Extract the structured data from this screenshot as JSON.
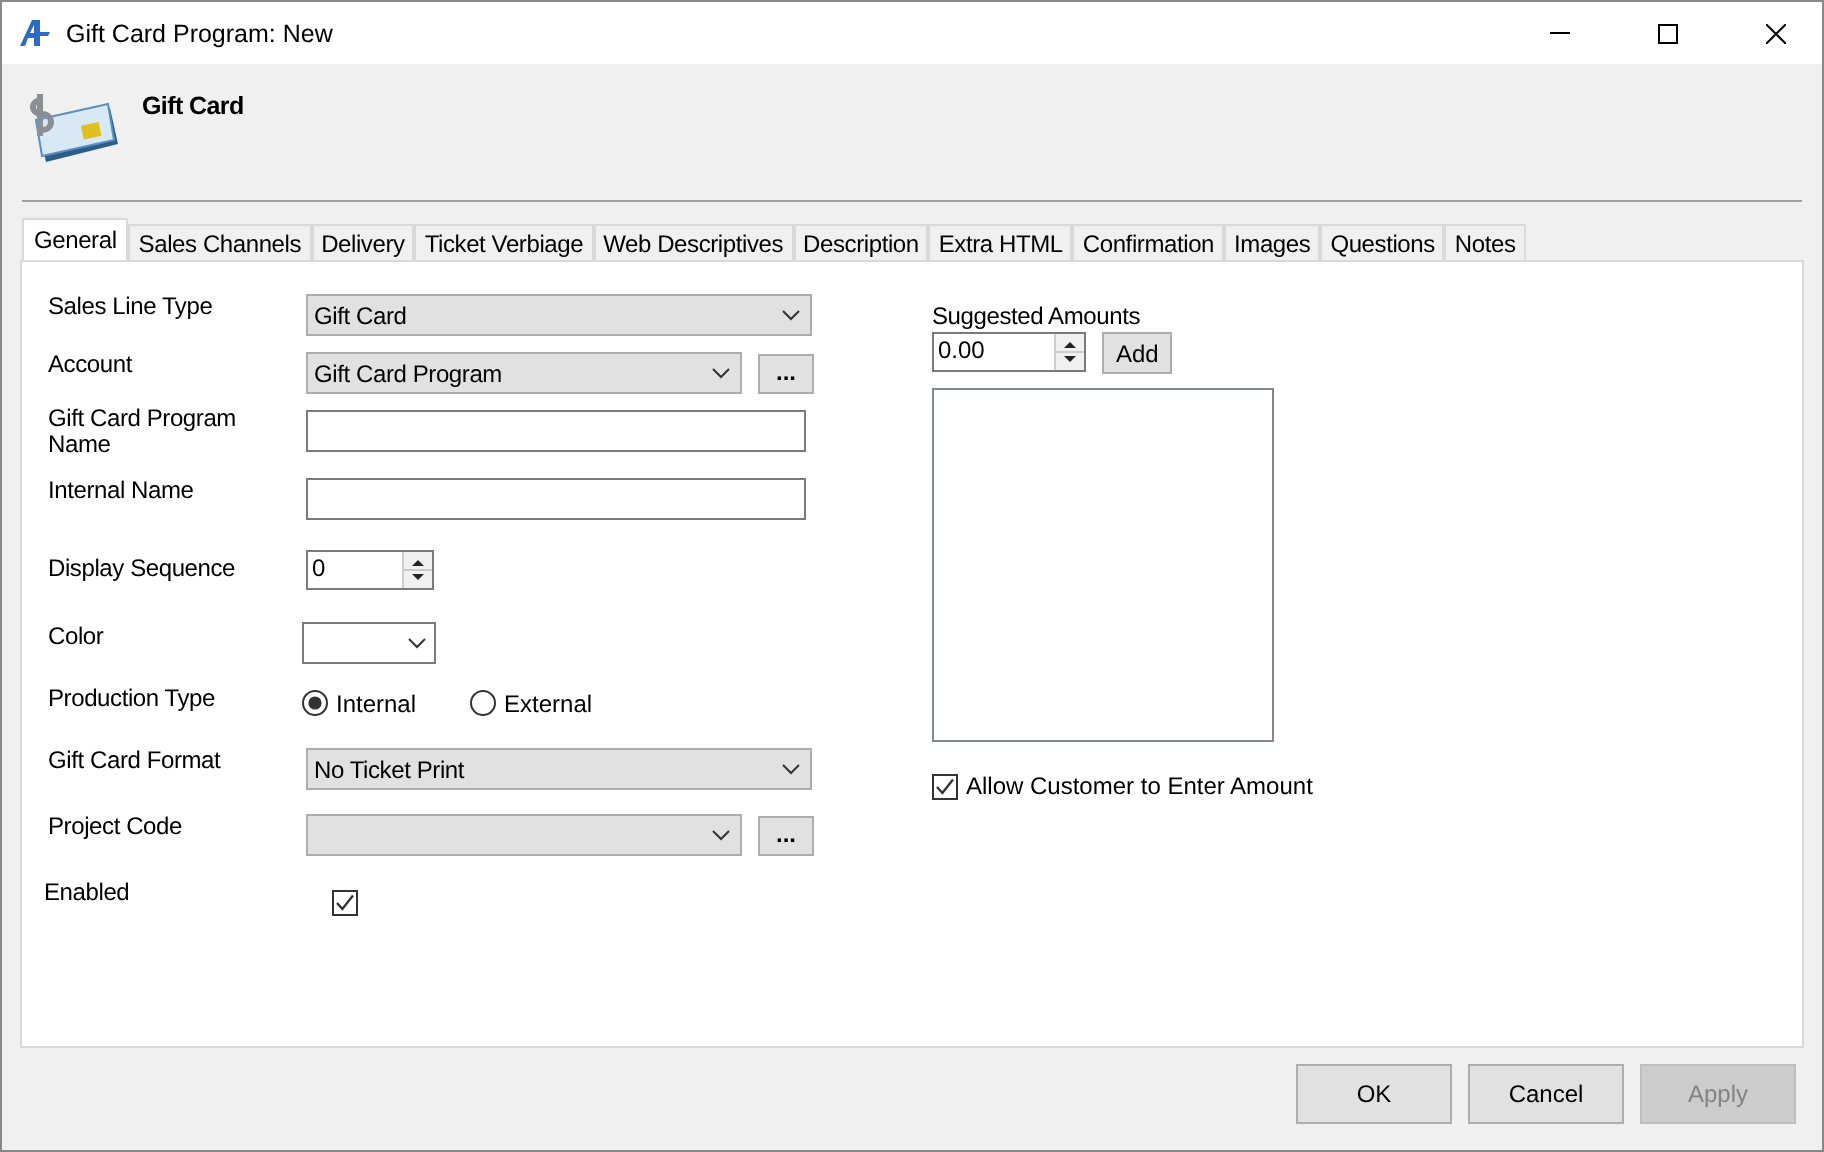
{
  "window": {
    "title": "Gift Card Program: New"
  },
  "header": {
    "title": "Gift Card"
  },
  "tabs": [
    {
      "label": "General",
      "selected": true
    },
    {
      "label": "Sales Channels",
      "selected": false
    },
    {
      "label": "Delivery",
      "selected": false
    },
    {
      "label": "Ticket Verbiage",
      "selected": false
    },
    {
      "label": "Web Descriptives",
      "selected": false
    },
    {
      "label": "Description",
      "selected": false
    },
    {
      "label": "Extra HTML",
      "selected": false
    },
    {
      "label": "Confirmation",
      "selected": false
    },
    {
      "label": "Images",
      "selected": false
    },
    {
      "label": "Questions",
      "selected": false
    },
    {
      "label": "Notes",
      "selected": false
    }
  ],
  "fields": [
    {
      "kind": "dropdown",
      "label": "Sales Line Type",
      "value": "Gift Card"
    },
    {
      "kind": "dropdown",
      "label": "Account",
      "value": "Gift Card Program",
      "browse": "..."
    },
    {
      "kind": "text",
      "label": "Gift Card Program Name"
    },
    {
      "kind": "text",
      "label": "Internal Name"
    },
    {
      "kind": "spinner",
      "label": "Display Sequence",
      "value": "0"
    },
    {
      "kind": "color",
      "label": "Color"
    },
    {
      "kind": "radio",
      "label": "Production Type",
      "options": [
        {
          "label": "Internal",
          "selected": true
        },
        {
          "label": "External",
          "selected": false
        }
      ]
    },
    {
      "kind": "dropdown",
      "label": "Gift Card Format",
      "value": "No Ticket Print"
    },
    {
      "kind": "dropdown",
      "label": "Project Code",
      "browse": "..."
    },
    {
      "kind": "checkbox",
      "label": "Enabled",
      "checked": true
    }
  ],
  "suggested_amounts": {
    "label": "Suggested Amounts",
    "value": "0.00",
    "add": "Add"
  },
  "allow_custom": {
    "label": "Allow Customer to Enter Amount",
    "checked": true
  },
  "buttons": [
    {
      "label": "OK",
      "disabled": false
    },
    {
      "label": "Cancel",
      "disabled": false
    },
    {
      "label": "Apply",
      "disabled": true
    }
  ]
}
